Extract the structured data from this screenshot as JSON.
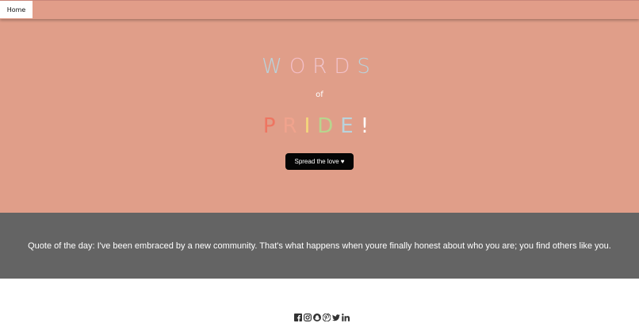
{
  "nav": {
    "home_label": "Home"
  },
  "hero": {
    "title_line1": [
      {
        "char": "W",
        "color": "#b9d3dc"
      },
      {
        "char": "O",
        "color": "#f4bfc9"
      },
      {
        "char": "R",
        "color": "#f0c7cf"
      },
      {
        "char": "D",
        "color": "#f2c2cb"
      },
      {
        "char": "S",
        "color": "#b9d3dc"
      }
    ],
    "connector": "of",
    "title_line2": [
      {
        "char": "P",
        "color": "#ee7561"
      },
      {
        "char": "R",
        "color": "#f0a38d"
      },
      {
        "char": "I",
        "color": "#f5d97a"
      },
      {
        "char": "D",
        "color": "#b8d58e"
      },
      {
        "char": "E",
        "color": "#b9d3dc"
      },
      {
        "char": "!",
        "color": "#ffffff"
      }
    ],
    "button_label": "Spread the love ♥"
  },
  "quote": {
    "text": "Quote of the day: I've been embraced by a new community. That's what happens when youre finally honest about who you are; you find others like you."
  },
  "footer": {
    "social_icons": [
      "facebook-icon",
      "instagram-icon",
      "snapchat-icon",
      "pinterest-icon",
      "twitter-icon",
      "linkedin-icon"
    ]
  },
  "colors": {
    "hero_bg": "#e09e89",
    "quote_bg": "#646464",
    "button_bg": "#050505"
  }
}
